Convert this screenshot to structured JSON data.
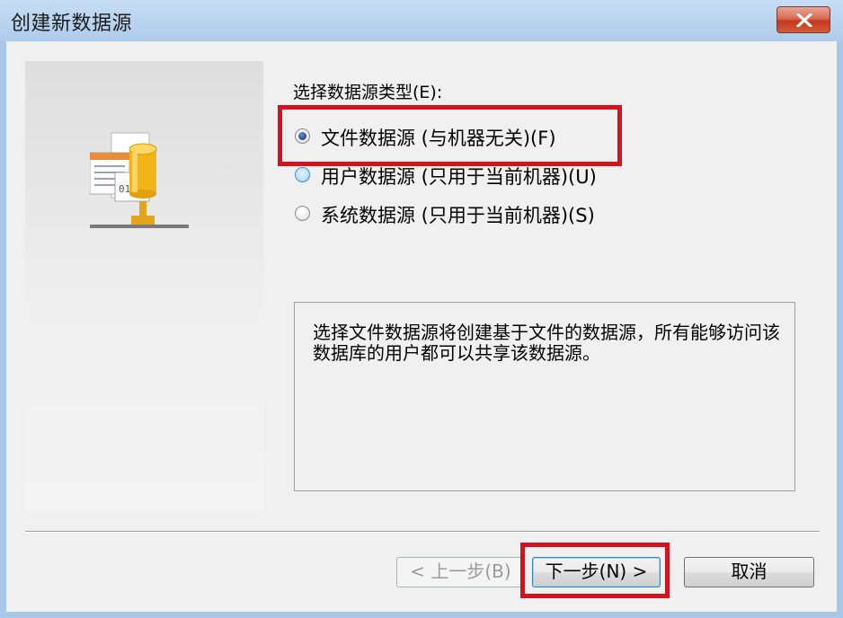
{
  "window": {
    "title": "创建新数据源",
    "close_icon": "close-x-icon",
    "accent_close": "#c8432a",
    "highlight_color": "#d2121c"
  },
  "sidebar": {
    "icon": "database-network-icon",
    "icon_text": "0111"
  },
  "group_label": "选择数据源类型(E):",
  "radios": [
    {
      "label": "文件数据源 (与机器无关)(F)",
      "checked": true,
      "highlighted": true
    },
    {
      "label": "用户数据源 (只用于当前机器)(U)",
      "checked": false,
      "highlighted": false
    },
    {
      "label": "系统数据源 (只用于当前机器)(S)",
      "checked": false,
      "highlighted": false
    }
  ],
  "description": "选择文件数据源将创建基于文件的数据源，所有能够访问该数据库的用户都可以共享该数据源。",
  "buttons": {
    "back_label": "< 上一步(B)",
    "next_label": "下一步(N) >",
    "cancel_label": "取消"
  }
}
